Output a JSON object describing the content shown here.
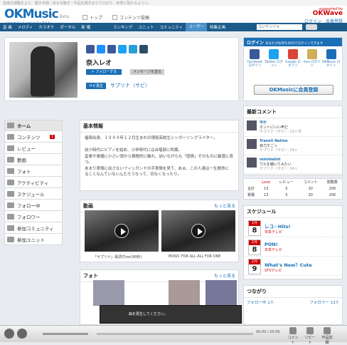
{
  "top_strip": "音楽の感動をより、聴き手側・出せる聴き・作品を聞きるマクロがり、世界に現れるように。",
  "brand": {
    "name": "OKMusic",
    "tag": "Beta",
    "sub": "ソーシャル・ミュージック・サイト"
  },
  "header_links": [
    "トップ",
    "コンテンツ投稿"
  ],
  "okwave": {
    "supported": "supported by",
    "name": "OKWave"
  },
  "account": {
    "login": "ログイン",
    "register": "会員登録"
  },
  "nav": {
    "items": [
      "音 曲",
      "メロディ",
      "カラオケ",
      "ポータル",
      "新 譜",
      "ランキング",
      "ユニット",
      "コミュニティ",
      "ユーザー",
      "特集企画"
    ],
    "active": "ユーザー",
    "search_value": "コンテンツ ▾"
  },
  "profile": {
    "name": "奈入レオ",
    "follow_btn": "＋ フォローする",
    "message_btn": "メッセージを送る",
    "sample_btn": "サビ再生",
    "sample_title": "サプリナ（サビ）",
    "share_colors": [
      "#3b5998",
      "#1e90ff",
      "#3b5998",
      "#1da1f2",
      "#2a9fd6",
      "#2a9fd6"
    ]
  },
  "sidebar": {
    "items": [
      {
        "label": "ホーム",
        "icon": "home-icon"
      },
      {
        "label": "コンテンツ",
        "icon": "content-icon",
        "badge": "1"
      },
      {
        "label": "レビュー",
        "icon": "review-icon"
      },
      {
        "label": "動画",
        "icon": "video-icon"
      },
      {
        "label": "フォト",
        "icon": "photo-icon"
      },
      {
        "label": "アクティビティ",
        "icon": "activity-icon"
      },
      {
        "label": "スケジュール",
        "icon": "schedule-icon"
      },
      {
        "label": "フォロー中",
        "icon": "following-icon"
      },
      {
        "label": "フォロワー",
        "icon": "follower-icon"
      },
      {
        "label": "参加コミュニティ",
        "icon": "community-icon"
      },
      {
        "label": "参加ユニット",
        "icon": "unit-icon"
      }
    ]
  },
  "basic_info": {
    "title": "基本情報",
    "lines": [
      "福岡出身、１９９４年１２月生まれの現役高校生シンガーソングライター。",
      "幼少時代にピアノを始め、小学時代には合唱部に所属。",
      "音楽や楽譜に小さい頃から積極的に触れ、幼いながらも「感情」そのものに敏感に育つ。",
      "あまり表情に出さないフィンガンドの手表情を見て、あぁ、この人達は一生懸命に",
      "ることなんていないんだろうなって、切なくなったり。"
    ]
  },
  "videos": {
    "title": "動画",
    "more": "もっと見る",
    "items": [
      {
        "caption": "「サプリナ」歌詞付ver(90秒)"
      },
      {
        "caption": "MUSIC FOR ALL ALL FOR ONE"
      }
    ]
  },
  "photos": {
    "title": "フォト",
    "more": "もっと見る"
  },
  "login_panel": {
    "title": "ログイン",
    "subtitle": "あなたがお持ちのIDでログインできます",
    "providers": [
      {
        "name": "Facebook ログイン",
        "color": "#3b5998"
      },
      {
        "name": "Twitter ログイン",
        "color": "#1da1f2"
      },
      {
        "name": "Google ログイン",
        "color": "#db4437"
      },
      {
        "name": "mixi ログイン",
        "color": "#d1ad59"
      },
      {
        "name": "OKMusic ログイン",
        "color": "#1a6fb5"
      }
    ],
    "register": "OKMusicに会員登録"
  },
  "activity": {
    "title": "最新コメント",
    "items": [
      {
        "user": "ゆか",
        "text": "ホントにいい声だ",
        "meta": "サプリナ（サビ）・12ヶ月"
      },
      {
        "user": "Transit Nation",
        "text": "目力すごっ",
        "meta": "サプリナ（サビ）・24ヶ"
      },
      {
        "user": "minimalist",
        "text": "ワルを聴いてみたい",
        "meta": "サプリナ（サビ）・24ヶ"
      }
    ]
  },
  "stats": {
    "headers": [
      "",
      "Love",
      "レビュー",
      "コメント",
      "閲覧数"
    ],
    "rows": [
      [
        "合計",
        "13",
        "3",
        "20",
        "200"
      ],
      [
        "累積",
        "13",
        "3",
        "20",
        "200"
      ]
    ]
  },
  "schedule": {
    "title": "スケジュール",
    "items": [
      {
        "month": "2月",
        "day": "8",
        "title": "レコ☆Hits!",
        "sub": "日本テレビ"
      },
      {
        "month": "2月",
        "day": "8",
        "title": "PON!",
        "sub": "日本テレビ"
      },
      {
        "month": "2月",
        "day": "9",
        "title": "What's New？Cute",
        "sub": "STVテレビ"
      }
    ]
  },
  "connections": {
    "title": "つながり",
    "following": "フォロー中 1人",
    "followers": "フォロワー 13人"
  },
  "player": {
    "time": "00:00 / 00:00",
    "icons": [
      "コメント",
      "リピート",
      "作品詳細"
    ],
    "mini_label": "曲を再生してください。"
  }
}
